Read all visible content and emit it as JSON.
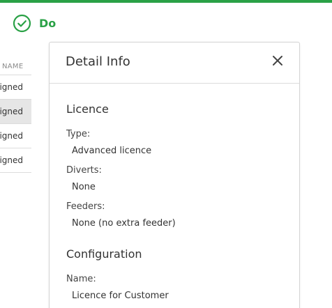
{
  "header": {
    "title": "Do",
    "icon": "check-circle-icon",
    "accent_color": "#2aa146"
  },
  "background_table": {
    "column_header": "NAME",
    "rows": [
      "igned",
      "igned",
      "igned",
      "igned"
    ],
    "selected_row_index": 1
  },
  "detail_panel": {
    "title": "Detail Info",
    "close_icon": "close-icon",
    "sections": [
      {
        "title": "Licence",
        "fields": [
          {
            "label": "Type:",
            "value": "Advanced licence"
          },
          {
            "label": "Diverts:",
            "value": "None"
          },
          {
            "label": "Feeders:",
            "value": "None (no extra feeder)"
          }
        ]
      },
      {
        "title": "Configuration",
        "fields": [
          {
            "label": "Name:",
            "value": "Licence for Customer"
          }
        ]
      }
    ]
  }
}
